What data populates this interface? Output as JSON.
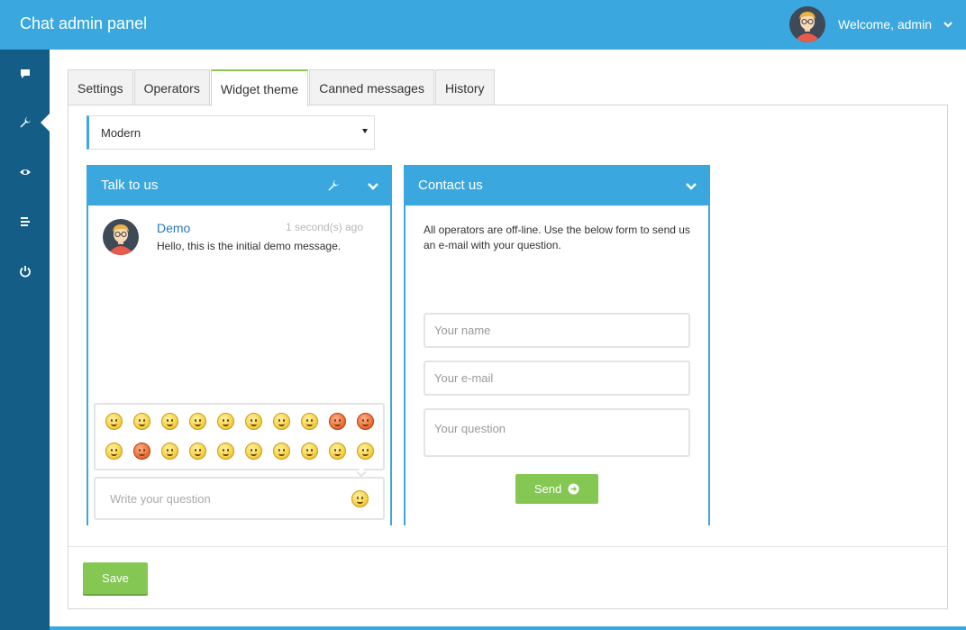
{
  "header": {
    "title": "Chat admin panel",
    "welcome": "Welcome, admin",
    "avatar_icon": "user-avatar-icon",
    "dropdown_icon": "chevron-down-icon"
  },
  "sidebar": {
    "items": [
      {
        "name": "chat",
        "icon": "chat-bubble-icon",
        "active": false
      },
      {
        "name": "settings",
        "icon": "wrench-icon",
        "active": true
      },
      {
        "name": "monitor",
        "icon": "eye-icon",
        "active": false
      },
      {
        "name": "history",
        "icon": "list-icon",
        "active": false
      },
      {
        "name": "logout",
        "icon": "power-icon",
        "active": false
      }
    ]
  },
  "tabs": [
    {
      "label": "Settings",
      "active": false
    },
    {
      "label": "Operators",
      "active": false
    },
    {
      "label": "Widget theme",
      "active": true
    },
    {
      "label": "Canned messages",
      "active": false
    },
    {
      "label": "History",
      "active": false
    }
  ],
  "theme_select": {
    "value": "Modern"
  },
  "chat_widget": {
    "title": "Talk to us",
    "message": {
      "sender": "Demo",
      "time": "1 second(s) ago",
      "text": "Hello, this is the initial demo message."
    },
    "input_placeholder": "Write your question",
    "emoji_count": 20
  },
  "contact_widget": {
    "title": "Contact us",
    "offline_text": "All operators are off-line. Use the below form to send us an e-mail with your question.",
    "name_placeholder": "Your name",
    "email_placeholder": "Your e-mail",
    "question_placeholder": "Your question",
    "send_label": "Send"
  },
  "save_label": "Save",
  "colors": {
    "accent": "#3aa8df",
    "sidebar": "#135d86",
    "success": "#84c753",
    "link": "#2a7ab8"
  }
}
